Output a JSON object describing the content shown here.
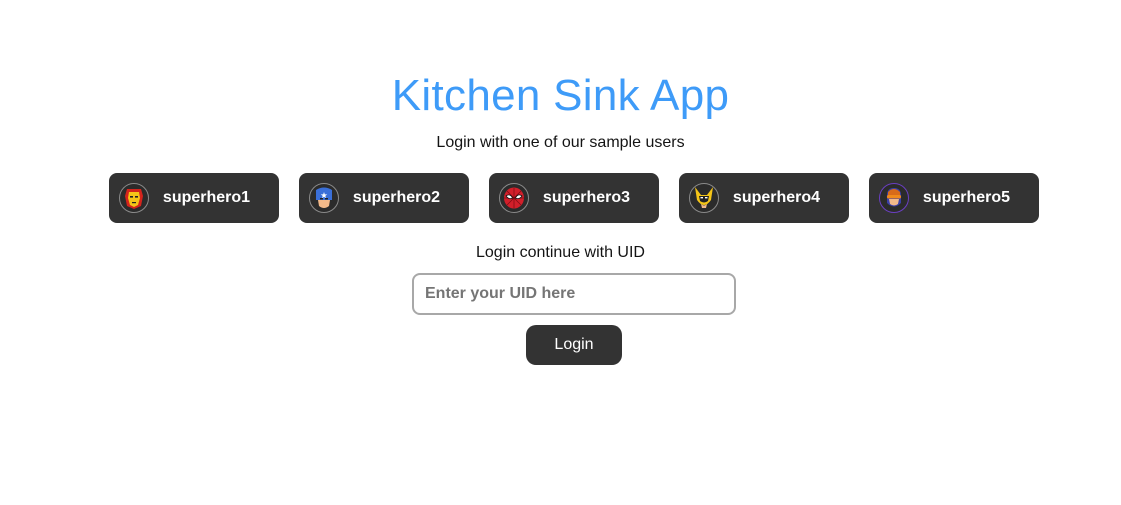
{
  "header": {
    "title": "Kitchen Sink App",
    "subtitle": "Login with one of our sample users"
  },
  "sample_users": [
    {
      "label": "superhero1",
      "icon": "iron-man-icon"
    },
    {
      "label": "superhero2",
      "icon": "captain-america-icon"
    },
    {
      "label": "superhero3",
      "icon": "spider-man-icon"
    },
    {
      "label": "superhero4",
      "icon": "wolverine-icon"
    },
    {
      "label": "superhero5",
      "icon": "cyclops-icon"
    }
  ],
  "uid_login": {
    "label": "Login continue with UID",
    "placeholder": "Enter your UID here",
    "value": "",
    "button_label": "Login"
  },
  "colors": {
    "title": "#3e9bf8",
    "button_bg": "#333333",
    "button_text": "#ffffff"
  }
}
